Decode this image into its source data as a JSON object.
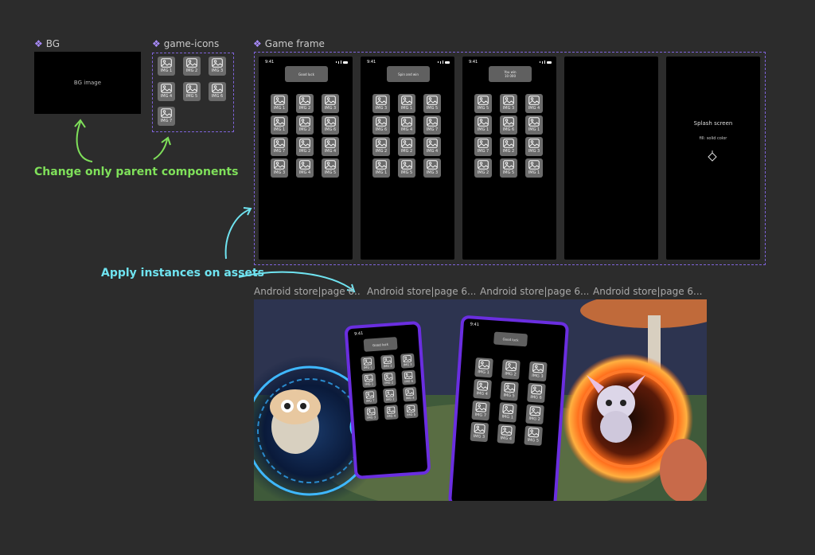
{
  "bg_component": {
    "title": "BG",
    "box_label": "BG image"
  },
  "icons_component": {
    "title": "game-icons",
    "icons": [
      "IMG 1",
      "IMG 2",
      "IMG 3",
      "IMG 4",
      "IMG 5",
      "IMG 6",
      "IMG 7"
    ]
  },
  "game_frame": {
    "title": "Game frame",
    "status_time": "9:41",
    "screens": [
      {
        "message": "Good luck",
        "grid": [
          "IMG 1",
          "IMG 2",
          "IMG 3",
          "IMG 1",
          "IMG 2",
          "IMG 6",
          "IMG 7",
          "IMG 2",
          "IMG 4",
          "IMG 3",
          "IMG 4",
          "IMG 5"
        ]
      },
      {
        "message": "Spin and win",
        "grid": [
          "IMG 3",
          "IMG 1",
          "IMG 5",
          "IMG 6",
          "IMG 4",
          "IMG 7",
          "IMG 2",
          "IMG 2",
          "IMG 4",
          "IMG 1",
          "IMG 5",
          "IMG 3"
        ]
      },
      {
        "message": "You win\n10 000",
        "grid": [
          "IMG 5",
          "IMG 3",
          "IMG 4",
          "IMG 1",
          "IMG 6",
          "IMG 1",
          "IMG 7",
          "IMG 2",
          "IMG 3",
          "IMG 2",
          "IMG 5",
          "IMG 1"
        ]
      },
      {
        "message": "",
        "grid": []
      },
      {
        "splash_title": "Splash screen",
        "splash_sub": "fill: solid color"
      }
    ]
  },
  "annotations": {
    "parent_note": "Change only parent components",
    "instances_note": "Apply instances on assets"
  },
  "store_labels": [
    "Android store|page 6...",
    "Android store|page 6...",
    "Android store|page 6...",
    "Android store|page 6..."
  ],
  "banner": {
    "phone_left": {
      "message": "Good luck",
      "grid": [
        "IMG 1",
        "IMG 2",
        "IMG 3",
        "IMG 1",
        "IMG 2",
        "IMG 6",
        "IMG 7",
        "IMG 2",
        "IMG 4",
        "IMG 3",
        "IMG 4",
        "IMG 5"
      ]
    },
    "phone_right": {
      "message": "Good luck",
      "grid": [
        "IMG 1",
        "IMG 2",
        "IMG 3",
        "IMG 4",
        "IMG 5",
        "IMG 6",
        "IMG 7",
        "IMG 1",
        "IMG 2",
        "IMG 3",
        "IMG 4",
        "IMG 5"
      ]
    }
  },
  "colors": {
    "accent_green": "#7fe05a",
    "accent_cyan": "#6fe3f0",
    "component_purple": "#a98bff",
    "dash_purple": "#7e63d8",
    "phone_frame_purple": "#6a2ee0"
  }
}
